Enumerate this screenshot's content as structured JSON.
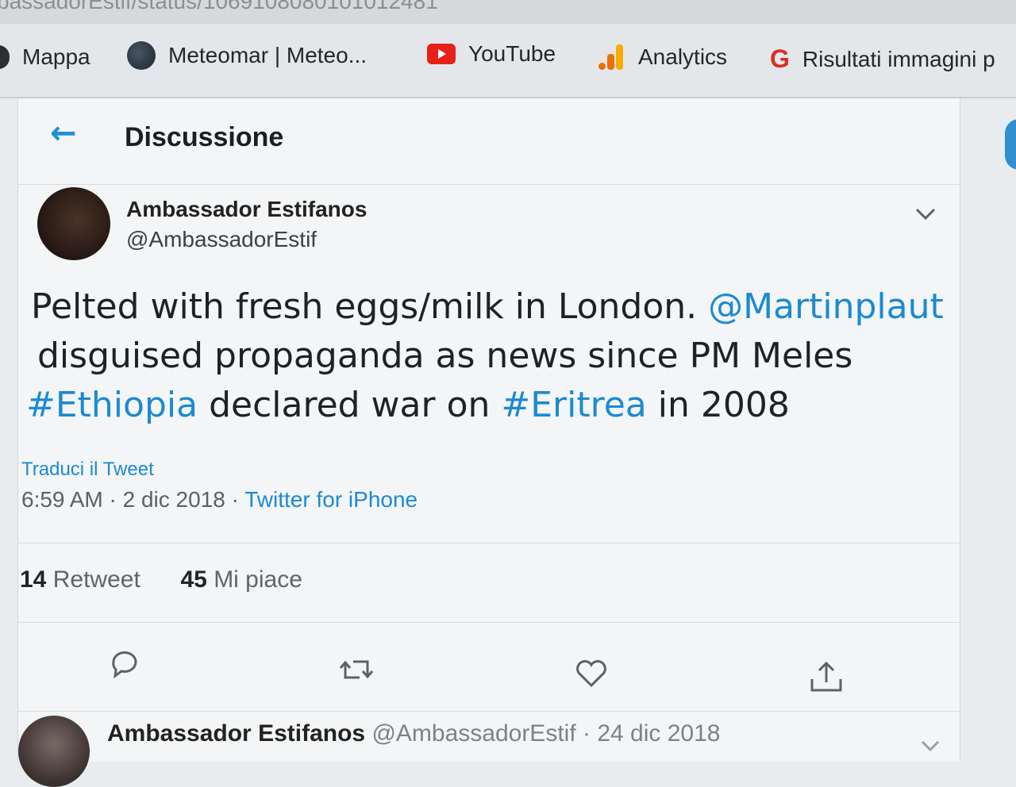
{
  "browser": {
    "url_fragment": "bassadorEstif/status/1069108080101012481"
  },
  "bookmarks": [
    {
      "label": "Mappa",
      "icon": "map-icon"
    },
    {
      "label": "Meteomar | Meteo...",
      "icon": "globe-icon"
    },
    {
      "label": "YouTube",
      "icon": "youtube-icon"
    },
    {
      "label": "Analytics",
      "icon": "analytics-icon"
    },
    {
      "label": "Risultati immagini p",
      "icon": "google-icon"
    }
  ],
  "header": {
    "back_icon": "arrow-left-icon",
    "title": "Discussione"
  },
  "tweet": {
    "author_name": "Ambassador Estifanos",
    "author_handle": "@AmbassadorEstif",
    "line1_text": "Pelted with fresh eggs/milk in London. ",
    "line1_mention": "@Martinplaut",
    "line2_text": "disguised propaganda as news since PM Meles",
    "line3_hashtag1": "#Ethiopia",
    "line3_mid": " declared war on ",
    "line3_hashtag2": "#Eritrea",
    "line3_end": " in 2008",
    "translate_label": "Traduci il Tweet",
    "time": "6:59 AM",
    "date": "2 dic 2018",
    "source": "Twitter for iPhone",
    "retweet_count": "14",
    "retweet_label": "Retweet",
    "like_count": "45",
    "like_label": "Mi piace"
  },
  "actions": [
    "reply-icon",
    "retweet-icon",
    "like-icon",
    "share-icon"
  ],
  "reply": {
    "author_name": "Ambassador Estifanos",
    "author_handle": "@AmbassadorEstif",
    "date": "24 dic 2018"
  },
  "colors": {
    "accent": "#1b8ad1",
    "text": "#1c2226",
    "muted": "#5a6168"
  }
}
